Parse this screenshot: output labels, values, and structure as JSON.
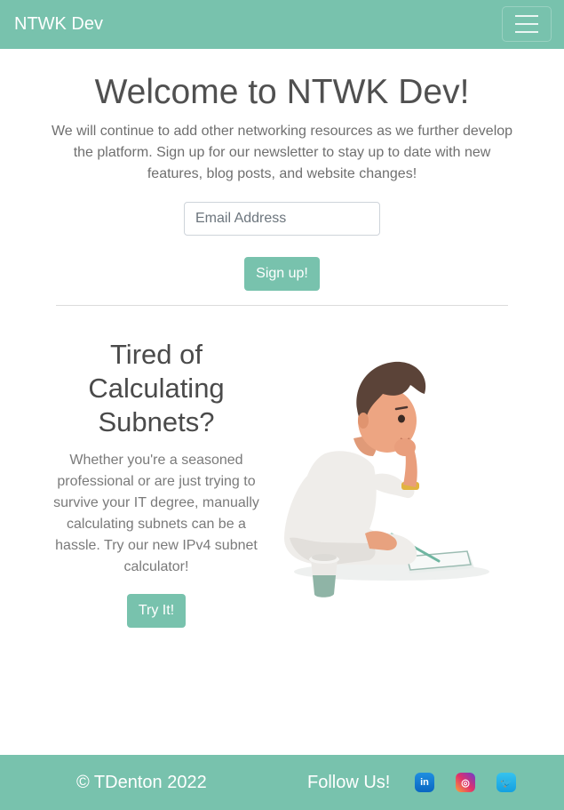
{
  "navbar": {
    "brand": "NTWK Dev",
    "menu_icon": "hamburger-menu-icon"
  },
  "hero": {
    "title": "Welcome to NTWK Dev!",
    "text": "We will continue to add other networking resources as we further develop the platform. Sign up for our newsletter to stay up to date with new features, blog posts, and website changes!",
    "email_placeholder": "Email Address",
    "signup_label": "Sign up!"
  },
  "feature": {
    "title": "Tired of Calculating Subnets?",
    "text": "Whether you're a seasoned professional or are just trying to survive your IT degree, manually calculating subnets can be a hassle. Try our new IPv4 subnet calculator!",
    "cta_label": "Try It!"
  },
  "footer": {
    "copyright": "© TDenton 2022",
    "follow": "Follow Us!",
    "social": [
      {
        "name": "linkedin-icon",
        "glyph": "in"
      },
      {
        "name": "instagram-icon",
        "glyph": "◎"
      },
      {
        "name": "twitter-icon",
        "glyph": "🐦"
      }
    ]
  },
  "colors": {
    "accent": "#78c2ad",
    "text": "#4a4a4a",
    "muted": "#6f6f6f"
  }
}
